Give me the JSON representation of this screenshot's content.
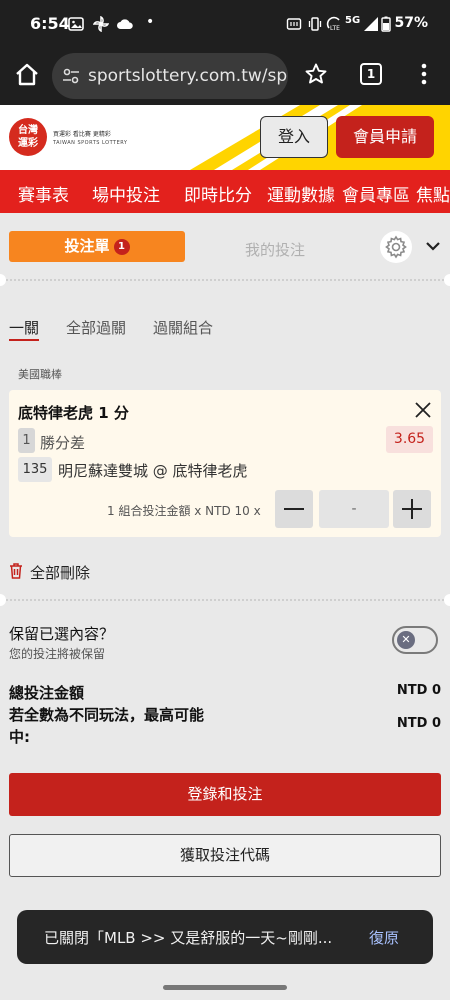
{
  "status_bar": {
    "time": "6:54",
    "dot": "•",
    "network": "5G",
    "battery": "57%"
  },
  "browser": {
    "url": "sportslottery.com.tw/spo",
    "tab_count": "1"
  },
  "site": {
    "logo_text_line1": "台灣",
    "logo_text_line2": "運彩",
    "logo_slogan": "買運彩 看比賽 更精彩",
    "logo_english": "TAIWAN SPORTS LOTTERY",
    "login_label": "登入",
    "register_label": "會員申請"
  },
  "nav": {
    "items": [
      "賽事表",
      "場中投注",
      "即時比分",
      "運動數據",
      "會員專區",
      "焦點"
    ]
  },
  "slip": {
    "tab_label": "投注單",
    "tab_badge": "1",
    "my_bets_label": "我的投注",
    "bet_types": [
      "一關",
      "全部過關",
      "過關組合"
    ],
    "league": "美國職棒",
    "bet": {
      "title": "底特律老虎 1 分",
      "selection_index": "1",
      "selection_type": "勝分差",
      "odds": "3.65",
      "match_number": "135",
      "match_name": "明尼蘇達雙城 @ 底特律老虎",
      "amount_label": "1 組合投注金額 x NTD 10 x",
      "stake_value": "-"
    },
    "delete_all_label": "全部刪除",
    "keep_title": "保留已選內容？",
    "keep_subtitle": "您的投注將被保留",
    "total_label": "總投注金額",
    "total_value": "NTD 0",
    "max_label": "若全數為不同玩法，最高可能中:",
    "max_value": "NTD 0",
    "primary_button": "登錄和投注",
    "secondary_button": "獲取投注代碼"
  },
  "toast": {
    "message": "已關閉「MLB >> 又是舒服的一天~剛剛...",
    "action": "復原"
  },
  "colors": {
    "brand_red": "#c4221c",
    "nav_red": "#e3211d",
    "accent_orange": "#f7851f",
    "stripe_yellow": "#ffd400"
  }
}
